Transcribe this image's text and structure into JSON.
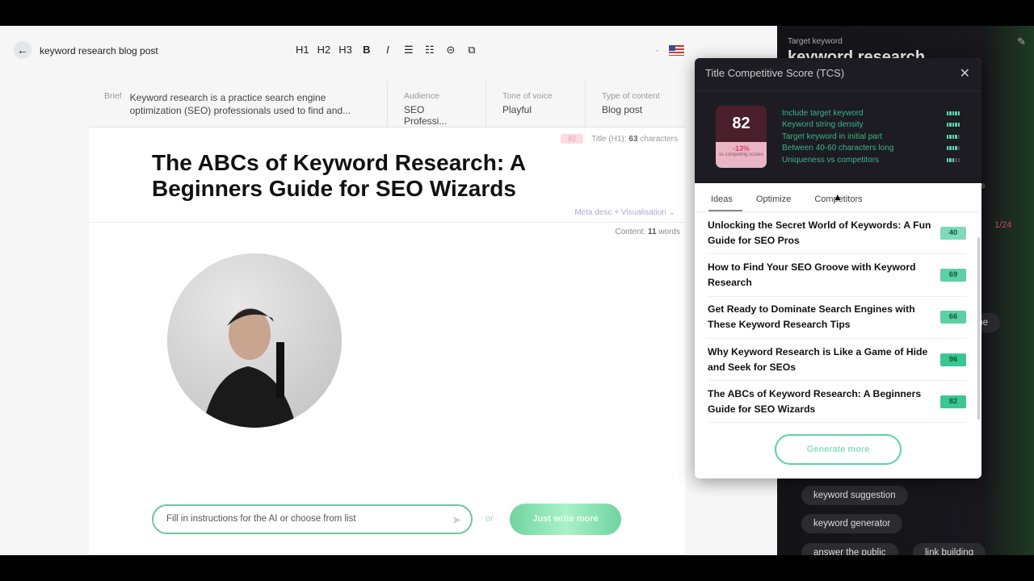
{
  "header": {
    "doc_title": "keyword research blog post",
    "tools": [
      "H1",
      "H2",
      "H3",
      "B",
      "I",
      "ordered-list",
      "bullet-list",
      "link",
      "copy"
    ]
  },
  "brief": {
    "brief_label": "Brief",
    "brief_text": "Keyword research is a practice search engine optimization (SEO) professionals used to find and...",
    "audience_label": "Audience",
    "audience": "SEO Professi...",
    "tone_label": "Tone of voice",
    "tone": "Playful",
    "type_label": "Type of content",
    "type": "Blog post"
  },
  "editor": {
    "title_score": "82",
    "title_meta_prefix": "Title (H1):",
    "title_chars": "63",
    "title_meta_suffix": "characters",
    "h1": "The ABCs of Keyword Research: A Beginners Guide for SEO Wizards",
    "meta_desc": "Meta desc + Visualisation ⌄",
    "content_prefix": "Content:",
    "content_words": "11",
    "content_suffix": "words",
    "ai_placeholder": "Fill in instructions for the AI or choose from list",
    "or": "or",
    "just_write": "Just write more"
  },
  "sidebar": {
    "target_label": "Target keyword",
    "target": "keyword research",
    "partial_text": "nts",
    "counter": "1/24",
    "partial_chip": "me",
    "chips": [
      "keyword suggestion",
      "keyword generator",
      "answer the public",
      "link building"
    ]
  },
  "tcs": {
    "title": "Title Competitive Score (TCS)",
    "score": "82",
    "delta": "-13%",
    "delta_label": "vs competing scores",
    "criteria": [
      {
        "label": "Include target keyword",
        "level": 5
      },
      {
        "label": "Keyword string density",
        "level": 5
      },
      {
        "label": "Target keyword in initial part",
        "level": 4
      },
      {
        "label": "Between 40-60 characters long",
        "level": 4
      },
      {
        "label": "Uniqueness vs competitors",
        "level": 3
      }
    ],
    "tabs": [
      "Ideas",
      "Optimize",
      "Competitors"
    ],
    "ideas": [
      {
        "title": "Unlocking the Secret World of Keywords: A Fun Guide for SEO Pros",
        "score": "40",
        "color": "#7fd9bb"
      },
      {
        "title": "How to Find Your SEO Groove with Keyword Research",
        "score": "69",
        "color": "#5dd0a5"
      },
      {
        "title": "Get Ready to Dominate Search Engines with These Keyword Research Tips",
        "score": "66",
        "color": "#5dd0a5"
      },
      {
        "title": "Why Keyword Research is Like a Game of Hide and Seek for SEOs",
        "score": "96",
        "color": "#3cc792"
      },
      {
        "title": "The ABCs of Keyword Research: A Beginners Guide for SEO Wizards",
        "score": "82",
        "color": "#3cc792"
      }
    ],
    "generate": "Generate more"
  },
  "colors": {
    "accent": "#5dd3aa",
    "score_bg": "#4a1e2a",
    "delta": "#d9446f"
  }
}
